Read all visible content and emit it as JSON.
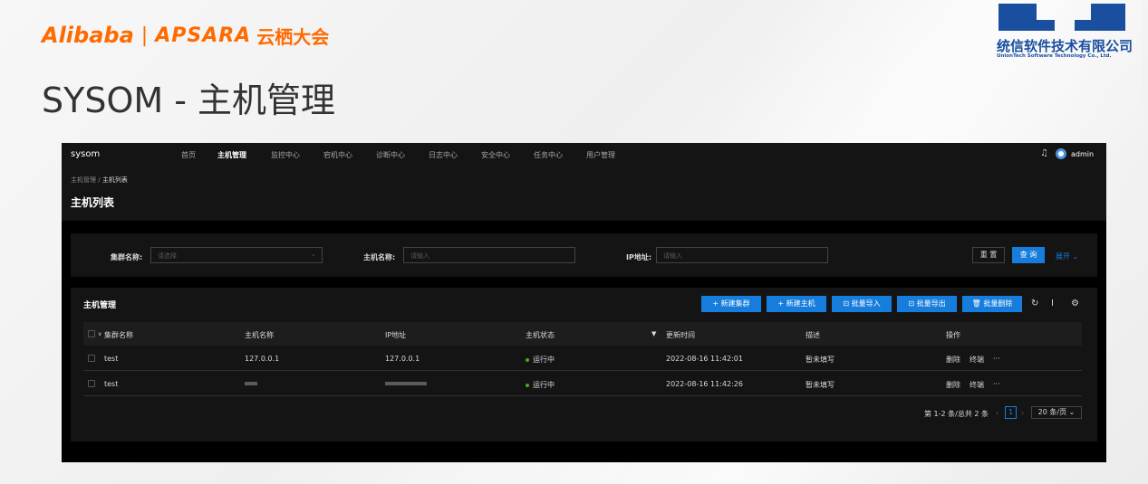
{
  "slide": {
    "brand": {
      "alibaba": "Alibaba",
      "separator": "|",
      "apsara": "APSARA",
      "yunqi": "云栖大会"
    },
    "title": "SYSOM - 主机管理",
    "partner_logo": {
      "name_cn": "统信软件技术有限公司",
      "name_en": "UnionTech Software Technology Co., Ltd."
    },
    "colors": {
      "alibaba_orange": "#ff6a00",
      "uniontech_blue": "#1a4fa0"
    }
  },
  "app": {
    "brand": "sysom",
    "nav": [
      "首页",
      "主机管理",
      "监控中心",
      "宕机中心",
      "诊断中心",
      "日志中心",
      "安全中心",
      "任务中心",
      "用户管理"
    ],
    "active_nav": "主机管理",
    "user": {
      "name": "admin",
      "bell_icon": "bell-icon"
    },
    "breadcrumb": {
      "parent": "主机管理",
      "sep": "/",
      "current": "主机列表"
    },
    "page_title": "主机列表",
    "filters": {
      "cluster_label": "集群名称:",
      "cluster_placeholder": "请选择",
      "hostname_label": "主机名称:",
      "hostname_placeholder": "请输入",
      "ip_label": "IP地址:",
      "ip_placeholder": "请输入",
      "reset": "重 置",
      "query": "查 询",
      "expand": "展开"
    },
    "table_card": {
      "title": "主机管理",
      "actions": {
        "new_cluster": "+ 新建集群",
        "new_host": "+ 新建主机",
        "batch_import": "⊡ 批量导入",
        "batch_export": "⊡ 批量导出",
        "batch_delete": "🗑 批量删除"
      },
      "columns": [
        "集群名称",
        "主机名称",
        "IP地址",
        "主机状态",
        "更新时间",
        "描述",
        "操作"
      ],
      "rows": [
        {
          "cluster": "test",
          "hostname": "127.0.0.1",
          "ip": "127.0.0.1",
          "status": "运行中",
          "updated": "2022-08-16 11:42:01",
          "desc": "暂未填写",
          "op_delete": "删除",
          "op_terminal": "终端",
          "op_more": "···"
        },
        {
          "cluster": "test",
          "hostname": "",
          "ip": "",
          "status": "运行中",
          "updated": "2022-08-16 11:42:26",
          "desc": "暂未填写",
          "op_delete": "删除",
          "op_terminal": "终端",
          "op_more": "···"
        }
      ],
      "pagination": {
        "summary": "第 1-2 条/总共 2 条",
        "current_page": "1",
        "page_size": "20 条/页"
      }
    },
    "colors": {
      "primary": "#177ddc",
      "success": "#49aa19",
      "bg": "#000000",
      "card": "#141414"
    }
  }
}
